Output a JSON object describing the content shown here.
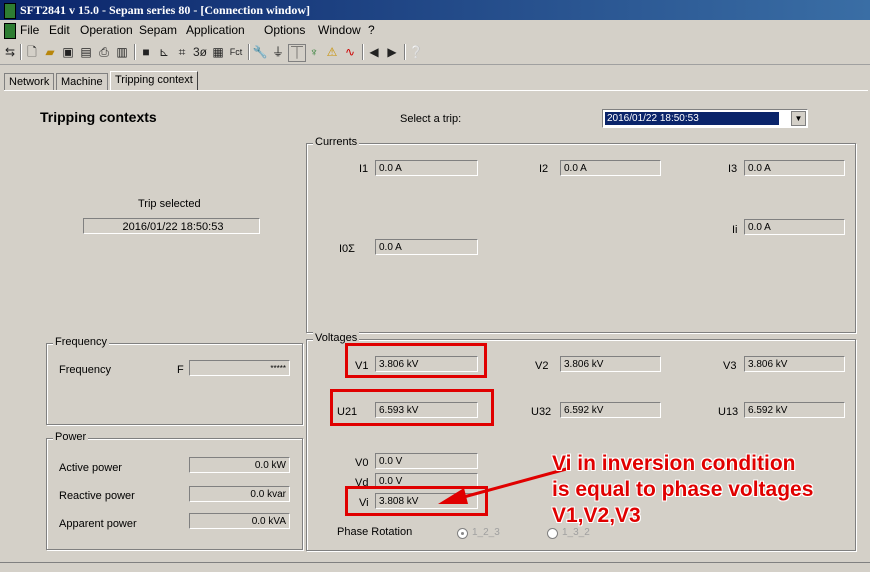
{
  "window": {
    "title": "SFT2841  v 15.0 - Sepam series 80 - [Connection window]"
  },
  "menu": [
    "File",
    "Edit",
    "Operation",
    "Sepam",
    "Application",
    "Options",
    "Window",
    "?"
  ],
  "tabs": [
    "Network",
    "Machine",
    "Tripping context"
  ],
  "header": {
    "heading": "Tripping contexts",
    "select_label": "Select a trip:",
    "select_value": "2016/01/22 18:50:53"
  },
  "trip": {
    "label": "Trip selected",
    "value": "2016/01/22 18:50:53"
  },
  "frequency": {
    "group": "Frequency",
    "label": "Frequency",
    "symbol": "F",
    "value": "*****"
  },
  "power": {
    "group": "Power",
    "active": {
      "label": "Active power",
      "value": "0.0 kW"
    },
    "reactive": {
      "label": "Reactive power",
      "value": "0.0 kvar"
    },
    "apparent": {
      "label": "Apparent power",
      "value": "0.0 kVA"
    }
  },
  "currents": {
    "group": "Currents",
    "i1": {
      "label": "I1",
      "value": "0.0 A"
    },
    "i2": {
      "label": "I2",
      "value": "0.0 A"
    },
    "i3": {
      "label": "I3",
      "value": "0.0 A"
    },
    "ii": {
      "label": "Ii",
      "value": "0.0 A"
    },
    "i0": {
      "label": "I0Σ",
      "value": "0.0 A"
    }
  },
  "voltages": {
    "group": "Voltages",
    "v1": {
      "label": "V1",
      "value": "3.806 kV"
    },
    "v2": {
      "label": "V2",
      "value": "3.806 kV"
    },
    "v3": {
      "label": "V3",
      "value": "3.806 kV"
    },
    "u21": {
      "label": "U21",
      "value": "6.593 kV"
    },
    "u32": {
      "label": "U32",
      "value": "6.592 kV"
    },
    "u13": {
      "label": "U13",
      "value": "6.592 kV"
    },
    "v0": {
      "label": "V0",
      "value": "0.0 V"
    },
    "vd": {
      "label": "Vd",
      "value": "0.0 V"
    },
    "vi": {
      "label": "Vi",
      "value": "3.808 kV"
    },
    "phase_rotation": "Phase Rotation",
    "rot1": "1_2_3",
    "rot2": "1_3_2"
  },
  "annotation": {
    "line1": "Vi in inversion condition",
    "line2": "is equal to phase voltages",
    "line3": "V1,V2,V3",
    "color": "#e00000"
  }
}
